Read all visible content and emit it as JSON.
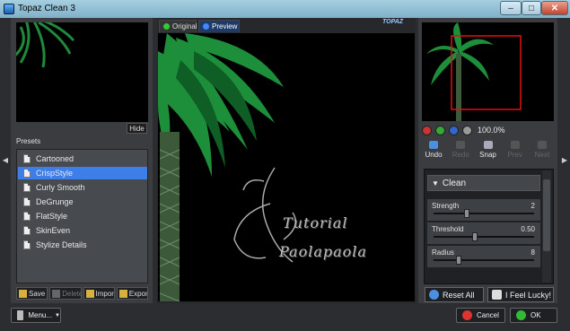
{
  "window": {
    "title": "Topaz Clean 3",
    "minimize": "–",
    "maximize": "□",
    "close": "✕"
  },
  "left": {
    "hide_label": "Hide",
    "presets_label": "Presets",
    "presets": [
      {
        "label": "Cartooned",
        "selected": false
      },
      {
        "label": "CrispStyle",
        "selected": true
      },
      {
        "label": "Curly Smooth",
        "selected": false
      },
      {
        "label": "DeGrunge",
        "selected": false
      },
      {
        "label": "FlatStyle",
        "selected": false
      },
      {
        "label": "SkinEven",
        "selected": false
      },
      {
        "label": "Stylize Details",
        "selected": false
      }
    ],
    "tools": {
      "save": "Save",
      "delete": "Delete",
      "import": "Import",
      "export": "Export"
    }
  },
  "preview": {
    "tab_original": "Original",
    "tab_preview": "Preview",
    "logo": "TOPAZ",
    "watermark_line1": "Tutorial",
    "watermark_line2": "Paolapaola"
  },
  "right": {
    "zoom": "100.0%",
    "history": {
      "undo": "Undo",
      "redo": "Redo",
      "snap": "Snap",
      "prev": "Prev",
      "next": "Next"
    },
    "section": "Clean",
    "params": [
      {
        "label": "Strength",
        "value": "2",
        "fraction": 0.33
      },
      {
        "label": "Threshold",
        "value": "0.50",
        "fraction": 0.41
      },
      {
        "label": "Radius",
        "value": "8",
        "fraction": 0.25
      }
    ],
    "reset_all": "Reset All",
    "feel_lucky": "I Feel Lucky!"
  },
  "footer": {
    "menu": "Menu...",
    "cancel": "Cancel",
    "ok": "OK"
  },
  "colors": {
    "accent": "#3e7ee8",
    "panel": "#3a3c40",
    "background": "#2b2d30",
    "nav_rect": "#e01010"
  }
}
